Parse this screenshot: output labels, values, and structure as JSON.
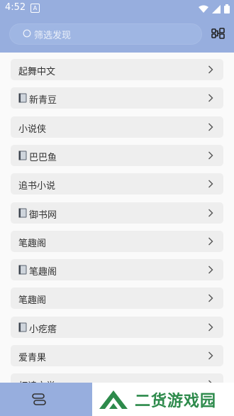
{
  "status_bar": {
    "time": "4:52",
    "notification_letter": "A"
  },
  "search": {
    "placeholder": "筛选发现"
  },
  "sources": [
    {
      "label": "起舞中文",
      "has_book_icon": false
    },
    {
      "label": "新青豆",
      "has_book_icon": true
    },
    {
      "label": "小说侠",
      "has_book_icon": false
    },
    {
      "label": "巴巴鱼",
      "has_book_icon": true
    },
    {
      "label": "追书小说",
      "has_book_icon": false
    },
    {
      "label": "御书网",
      "has_book_icon": true
    },
    {
      "label": "笔趣阁",
      "has_book_icon": false
    },
    {
      "label": "笔趣阁",
      "has_book_icon": true
    },
    {
      "label": "笔趣阁",
      "has_book_icon": false
    },
    {
      "label": "小疙瘩",
      "has_book_icon": true
    },
    {
      "label": "爱青果",
      "has_book_icon": false
    },
    {
      "label": "灯读文学",
      "has_book_icon": false
    }
  ],
  "watermark": {
    "text": "二货游戏园"
  },
  "colors": {
    "header": "#97aede",
    "item_bg": "#eeeeee",
    "watermark_green": "#2d8a4b"
  },
  "icons": {
    "search": "search-icon",
    "filter": "filter-icon",
    "chevron": "chevron-right-icon",
    "book": "book-icon",
    "nav": "layers-icon"
  }
}
